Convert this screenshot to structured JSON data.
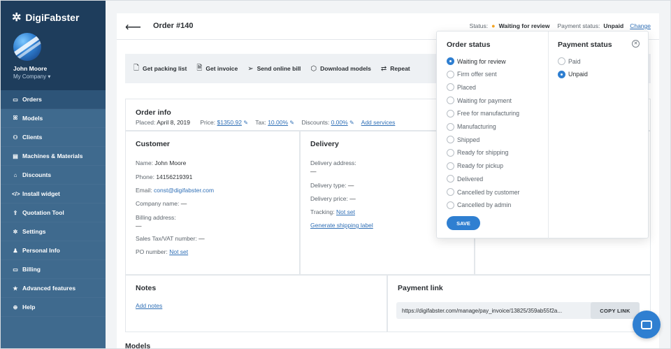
{
  "brand": {
    "name": "DigiFabster"
  },
  "user": {
    "name": "John Moore",
    "company": "My Company"
  },
  "sidebar": {
    "items": [
      {
        "label": "Orders",
        "icon": "card-icon",
        "glyph": "▭"
      },
      {
        "label": "Models",
        "icon": "models-icon",
        "glyph": "ꕤ"
      },
      {
        "label": "Clients",
        "icon": "clients-icon",
        "glyph": "⚇"
      },
      {
        "label": "Machines & Materials",
        "icon": "machines-icon",
        "glyph": "▤"
      },
      {
        "label": "Discounts",
        "icon": "discounts-icon",
        "glyph": "⌂"
      },
      {
        "label": "Install widget",
        "icon": "code-icon",
        "glyph": "</>"
      },
      {
        "label": "Quotation Tool",
        "icon": "upload-icon",
        "glyph": "⇪"
      },
      {
        "label": "Settings",
        "icon": "gear-icon",
        "glyph": "✲"
      },
      {
        "label": "Personal Info",
        "icon": "person-icon",
        "glyph": "♟"
      },
      {
        "label": "Billing",
        "icon": "billing-icon",
        "glyph": "▭"
      },
      {
        "label": "Advanced features",
        "icon": "star-icon",
        "glyph": "★"
      },
      {
        "label": "Help",
        "icon": "help-icon",
        "glyph": "⊕"
      }
    ]
  },
  "header": {
    "title": "Order #140",
    "status_label": "Status:",
    "status_value": "Waiting for review",
    "payment_label": "Payment status:",
    "payment_value": "Unpaid",
    "change": "Change"
  },
  "toolbar": {
    "items": [
      {
        "label": "Get packing list",
        "glyph": "🗋"
      },
      {
        "label": "Get invoice",
        "glyph": "🗎"
      },
      {
        "label": "Send online bill",
        "glyph": "➢"
      },
      {
        "label": "Download models",
        "glyph": "⬡"
      },
      {
        "label": "Repeat",
        "glyph": "⇄"
      }
    ]
  },
  "order_info": {
    "title": "Order info",
    "placed_label": "Placed:",
    "placed_value": "April 8, 2019",
    "price_label": "Price:",
    "price_value": "$1350.92",
    "tax_label": "Tax:",
    "tax_value": "10.00%",
    "discounts_label": "Discounts:",
    "discounts_value": "0.00%",
    "add_services": "Add services"
  },
  "customer": {
    "title": "Customer",
    "name_label": "Name:",
    "name_value": "John Moore",
    "phone_label": "Phone:",
    "phone_value": "14156219391",
    "email_label": "Email:",
    "email_value": "const@digifabster.com",
    "company_label": "Company name:",
    "company_value": "—",
    "billing_label": "Billing address:",
    "billing_value": "—",
    "vat_label": "Sales Tax/VAT number:",
    "vat_value": "—",
    "po_label": "PO number:",
    "po_value": "Not set"
  },
  "delivery": {
    "title": "Delivery",
    "address_label": "Delivery address:",
    "address_value": "—",
    "type_label": "Delivery type:",
    "type_value": "—",
    "price_label": "Delivery price:",
    "price_value": "—",
    "tracking_label": "Tracking:",
    "tracking_value": "Not set",
    "generate": "Generate shipping label"
  },
  "notes": {
    "title": "Notes",
    "add": "Add notes"
  },
  "payment_link": {
    "title": "Payment link",
    "url": "https://digifabster.com/manage/pay_invoice/13825/359ab55f2a...",
    "copy": "COPY LINK"
  },
  "models_heading": "Models",
  "popup": {
    "order_status_title": "Order status",
    "payment_status_title": "Payment status",
    "order_statuses": [
      {
        "label": "Waiting for review",
        "checked": true
      },
      {
        "label": "Firm offer sent",
        "checked": false
      },
      {
        "label": "Placed",
        "checked": false
      },
      {
        "label": "Waiting for payment",
        "checked": false
      },
      {
        "label": "Free for manufacturing",
        "checked": false
      },
      {
        "label": "Manufacturing",
        "checked": false
      },
      {
        "label": "Shipped",
        "checked": false
      },
      {
        "label": "Ready for shipping",
        "checked": false
      },
      {
        "label": "Ready for pickup",
        "checked": false
      },
      {
        "label": "Delivered",
        "checked": false
      },
      {
        "label": "Cancelled by customer",
        "checked": false
      },
      {
        "label": "Cancelled by admin",
        "checked": false
      }
    ],
    "payment_statuses": [
      {
        "label": "Paid",
        "checked": false
      },
      {
        "label": "Unpaid",
        "checked": true
      }
    ],
    "save": "SAVE"
  },
  "colors": {
    "sidebar": "#3f6a8e",
    "sidebar_top": "#1e3d5c",
    "accent": "#2f7fd1",
    "status_dot": "#f5a623"
  }
}
